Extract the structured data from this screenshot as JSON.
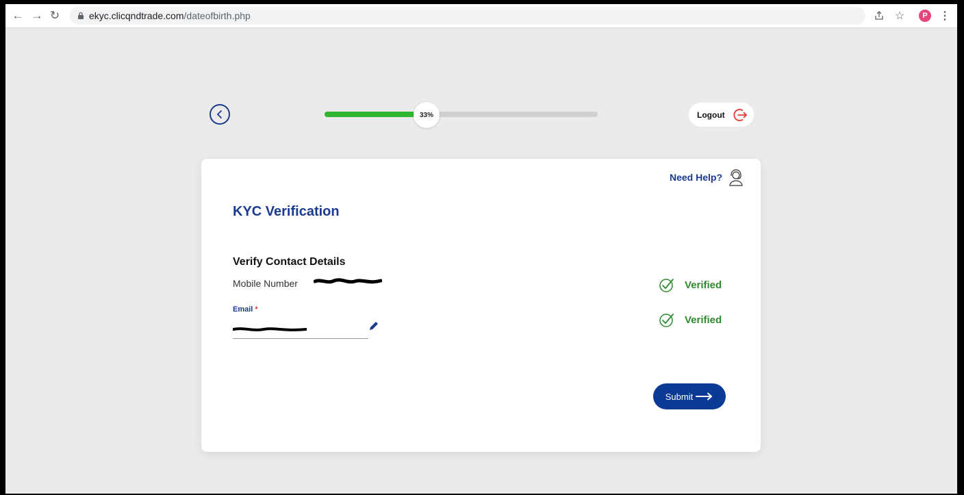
{
  "browser": {
    "url_domain": "ekyc.clicqndtrade.com",
    "url_path": "/dateofbirth.php",
    "profile_initial": "P"
  },
  "header": {
    "progress_label": "33%",
    "progress_value": 0.33,
    "logout_label": "Logout"
  },
  "card": {
    "help_label": "Need Help?",
    "title": "KYC Verification",
    "section_title": "Verify Contact Details",
    "mobile_label": "Mobile Number",
    "email_label": "Email",
    "email_required_mark": "*",
    "mobile_status": "Verified",
    "email_status": "Verified",
    "submit_label": "Submit"
  },
  "colors": {
    "brand": "#1a3a8f",
    "progress": "#2fb52f",
    "verified": "#2e8b2e",
    "logout_icon": "#e53935",
    "submit_bg": "#0a3a94"
  },
  "icons": [
    "back-arrow-icon",
    "lock-icon",
    "share-icon",
    "star-icon",
    "menu-dots-icon",
    "logout-icon",
    "headset-icon",
    "pencil-icon",
    "check-circle-icon",
    "arrow-right-icon"
  ]
}
